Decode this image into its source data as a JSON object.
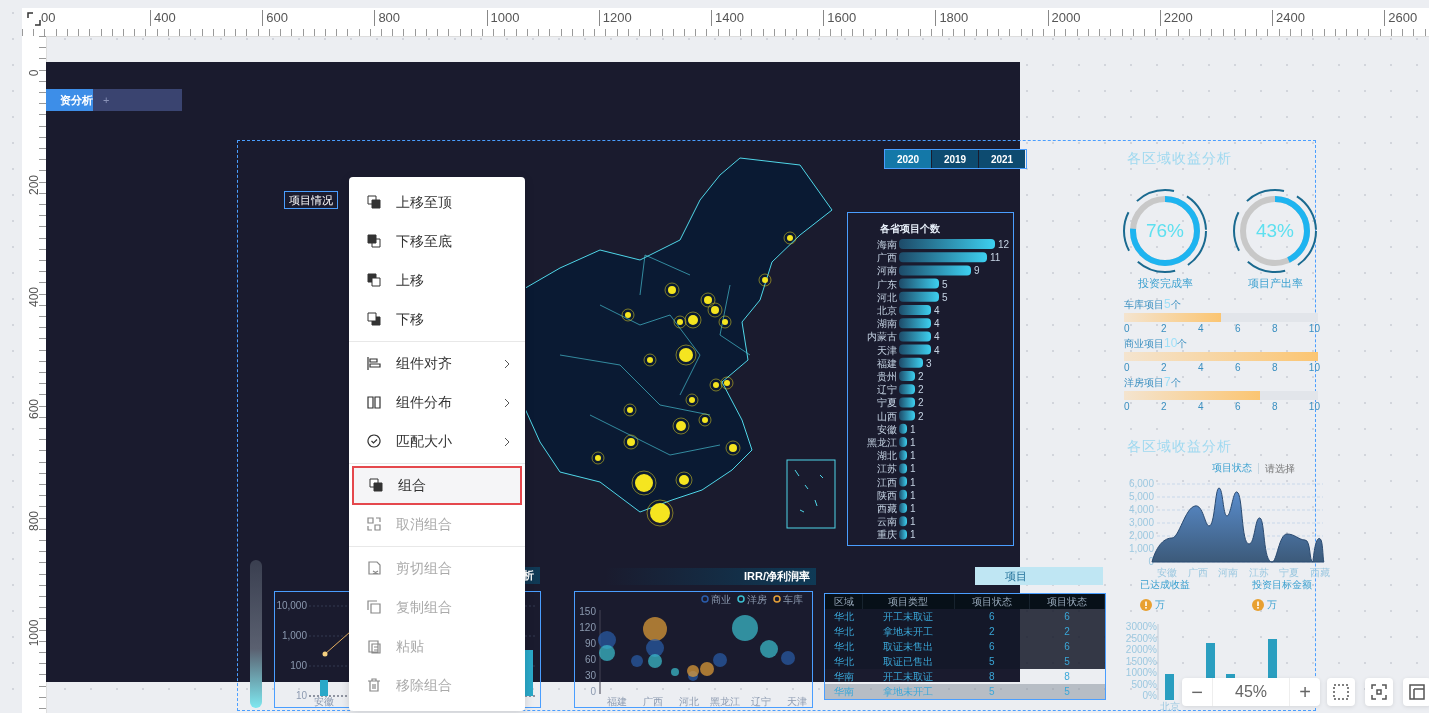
{
  "ruler": {
    "top_labels": [
      "00",
      "400",
      "600",
      "800",
      "1000",
      "1200",
      "1400",
      "1600",
      "1800",
      "2000",
      "2200",
      "2400",
      "2600"
    ],
    "left_labels": [
      "0",
      "200",
      "400",
      "600",
      "800",
      "1000"
    ]
  },
  "page_tabs": [
    {
      "label": "资分析",
      "selected": true
    },
    {
      "label": "+",
      "selected": false
    }
  ],
  "dashboard": {
    "title": {
      "text": "项目情况",
      "selected": true
    },
    "year_tabs": {
      "selected": true,
      "items": [
        {
          "label": "2020",
          "selected": true
        },
        {
          "label": "2019",
          "selected": false
        },
        {
          "label": "2021",
          "selected": false
        }
      ]
    },
    "province_chart": {
      "selected": true,
      "chart_data": {
        "type": "bar",
        "orientation": "horizontal",
        "title": "各省项目个数",
        "categories": [
          "海南",
          "广西",
          "河南",
          "广东",
          "河北",
          "北京",
          "湖南",
          "内蒙古",
          "天津",
          "福建",
          "贵州",
          "辽宁",
          "宁夏",
          "山西",
          "安徽",
          "黑龙江",
          "湖北",
          "江苏",
          "江西",
          "陕西",
          "西藏",
          "云南",
          "重庆"
        ],
        "values": [
          12,
          11,
          9,
          5,
          5,
          4,
          4,
          4,
          4,
          3,
          2,
          2,
          2,
          2,
          1,
          1,
          1,
          1,
          1,
          1,
          1,
          1,
          1
        ],
        "data_labels": true
      }
    },
    "bottom_left_chart": {
      "selected": true,
      "header": "析",
      "y_labels": [
        "10,000",
        "1,000",
        "100",
        "10"
      ],
      "x_labels": [
        "安徽"
      ]
    },
    "irr_chart": {
      "selected": true,
      "header": "IRR/净利润率",
      "legend": [
        {
          "label": "商业",
          "color": "#2a5caa"
        },
        {
          "label": "洋房",
          "color": "#3cc0d0"
        },
        {
          "label": "车库",
          "color": "#e5a038"
        }
      ],
      "y_labels": [
        "150",
        "120",
        "90",
        "60",
        "30",
        "0"
      ],
      "x_labels": [
        "福建",
        "广西",
        "河北",
        "黑龙江",
        "辽宁",
        "天津"
      ]
    },
    "project_table": {
      "selected": true,
      "header": "项目",
      "columns": [
        "区域",
        "项目类型",
        "项目状态",
        "项目状态"
      ],
      "rows": [
        [
          "华北",
          "开工未取证",
          "6",
          "6"
        ],
        [
          "华北",
          "拿地未开工",
          "2",
          "2"
        ],
        [
          "华北",
          "取证未售出",
          "6",
          "6"
        ],
        [
          "华北",
          "取证已售出",
          "5",
          "5"
        ],
        [
          "华南",
          "开工未取证",
          "8",
          "8"
        ],
        [
          "华南",
          "拿地未开工",
          "5",
          "5"
        ]
      ]
    }
  },
  "side": {
    "title_1": "各区域收益分析",
    "gauges": [
      {
        "label": "投资完成率",
        "reading": "76%",
        "level": 0.76
      },
      {
        "label": "项目产出率",
        "reading": "43%",
        "level": 0.43
      }
    ],
    "progress": [
      {
        "name": "车库项目",
        "count": "5",
        "unit": "个",
        "level": 0.5,
        "ticks": [
          "0",
          "2",
          "4",
          "6",
          "8",
          "10"
        ]
      },
      {
        "name": "商业项目",
        "count": "10",
        "unit": "个",
        "level": 1.0,
        "ticks": [
          "0",
          "2",
          "4",
          "6",
          "8",
          "10"
        ]
      },
      {
        "name": "洋房项目",
        "count": "7",
        "unit": "个",
        "level": 0.7,
        "ticks": [
          "0",
          "2",
          "4",
          "6",
          "8",
          "10"
        ]
      }
    ],
    "title_2": "各区域收益分析",
    "status_filter": {
      "label": "项目状态",
      "placeholder": "请选择"
    },
    "area_chart": {
      "y_labels": [
        "6,000",
        "5,000",
        "4,000",
        "3,000",
        "2,000",
        "1,000",
        "0"
      ],
      "x_labels": [
        "安徽",
        "广西",
        "河南",
        "江苏",
        "宁夏",
        "西藏"
      ]
    },
    "stat_cards": [
      {
        "label": "已达成收益",
        "unit": "万"
      },
      {
        "label": "投资目标金额",
        "unit": "万"
      }
    ],
    "percent_chart": {
      "y_labels": [
        "3000%",
        "2500%",
        "2000%",
        "1500%",
        "1000%",
        "500%",
        "0%"
      ],
      "x_labels": [
        "北京"
      ]
    }
  },
  "context_menu": {
    "groups": [
      [
        {
          "label": "上移至顶",
          "disabled": false,
          "highlighted": false,
          "submenu": false
        },
        {
          "label": "下移至底",
          "disabled": false,
          "highlighted": false,
          "submenu": false
        },
        {
          "label": "上移",
          "disabled": false,
          "highlighted": false,
          "submenu": false
        },
        {
          "label": "下移",
          "disabled": false,
          "highlighted": false,
          "submenu": false
        }
      ],
      [
        {
          "label": "组件对齐",
          "disabled": false,
          "highlighted": false,
          "submenu": true
        },
        {
          "label": "组件分布",
          "disabled": false,
          "highlighted": false,
          "submenu": true
        },
        {
          "label": "匹配大小",
          "disabled": false,
          "highlighted": false,
          "submenu": true
        }
      ],
      [
        {
          "label": "组合",
          "disabled": false,
          "highlighted": true,
          "submenu": false
        },
        {
          "label": "取消组合",
          "disabled": true,
          "highlighted": false,
          "submenu": false
        }
      ],
      [
        {
          "label": "剪切组合",
          "disabled": true,
          "highlighted": false,
          "submenu": false
        },
        {
          "label": "复制组合",
          "disabled": true,
          "highlighted": false,
          "submenu": false
        },
        {
          "label": "粘贴",
          "disabled": true,
          "highlighted": false,
          "submenu": false
        },
        {
          "label": "移除组合",
          "disabled": true,
          "highlighted": false,
          "submenu": false
        }
      ]
    ]
  },
  "zoom": {
    "minus": "−",
    "value": "45%",
    "plus": "+"
  }
}
